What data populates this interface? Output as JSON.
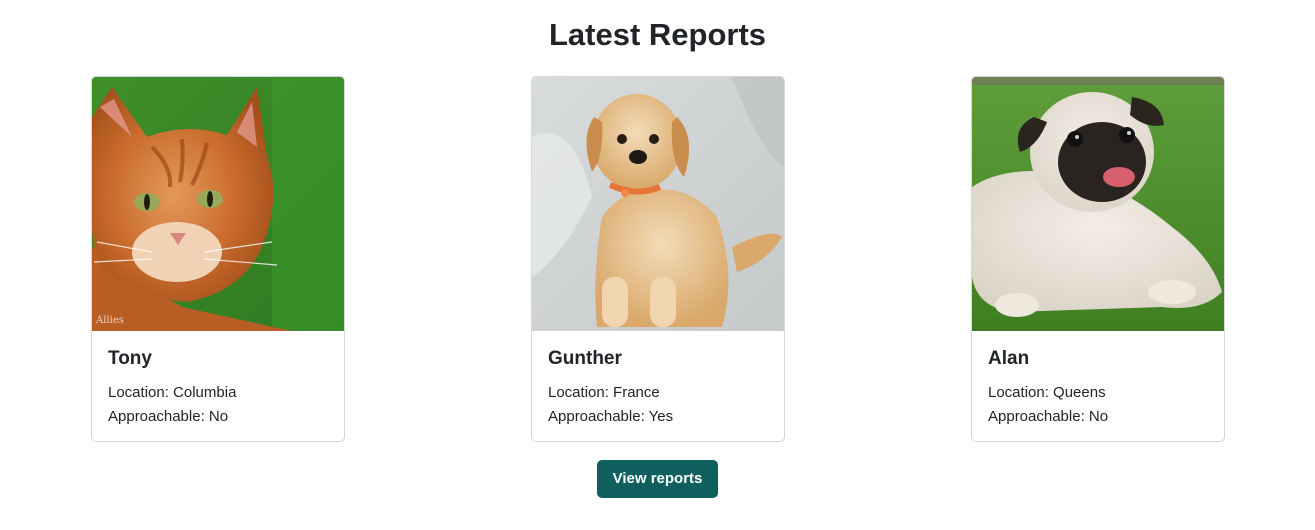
{
  "header": {
    "title": "Latest Reports"
  },
  "reports": [
    {
      "name": "Tony",
      "location": "Location: Columbia",
      "approachable": "Approachable: No",
      "photo_watermark": "Allies"
    },
    {
      "name": "Gunther",
      "location": "Location: France",
      "approachable": "Approachable: Yes"
    },
    {
      "name": "Alan",
      "location": "Location: Queens",
      "approachable": "Approachable: No"
    }
  ],
  "actions": {
    "view_reports_label": "View reports"
  },
  "colors": {
    "button": "#0f5f5f",
    "card_border": "#d4d6d9",
    "text": "#212529"
  },
  "images": [
    "orange-tabby-cat-photo",
    "golden-retriever-puppy-photo",
    "pug-on-grass-photo"
  ]
}
